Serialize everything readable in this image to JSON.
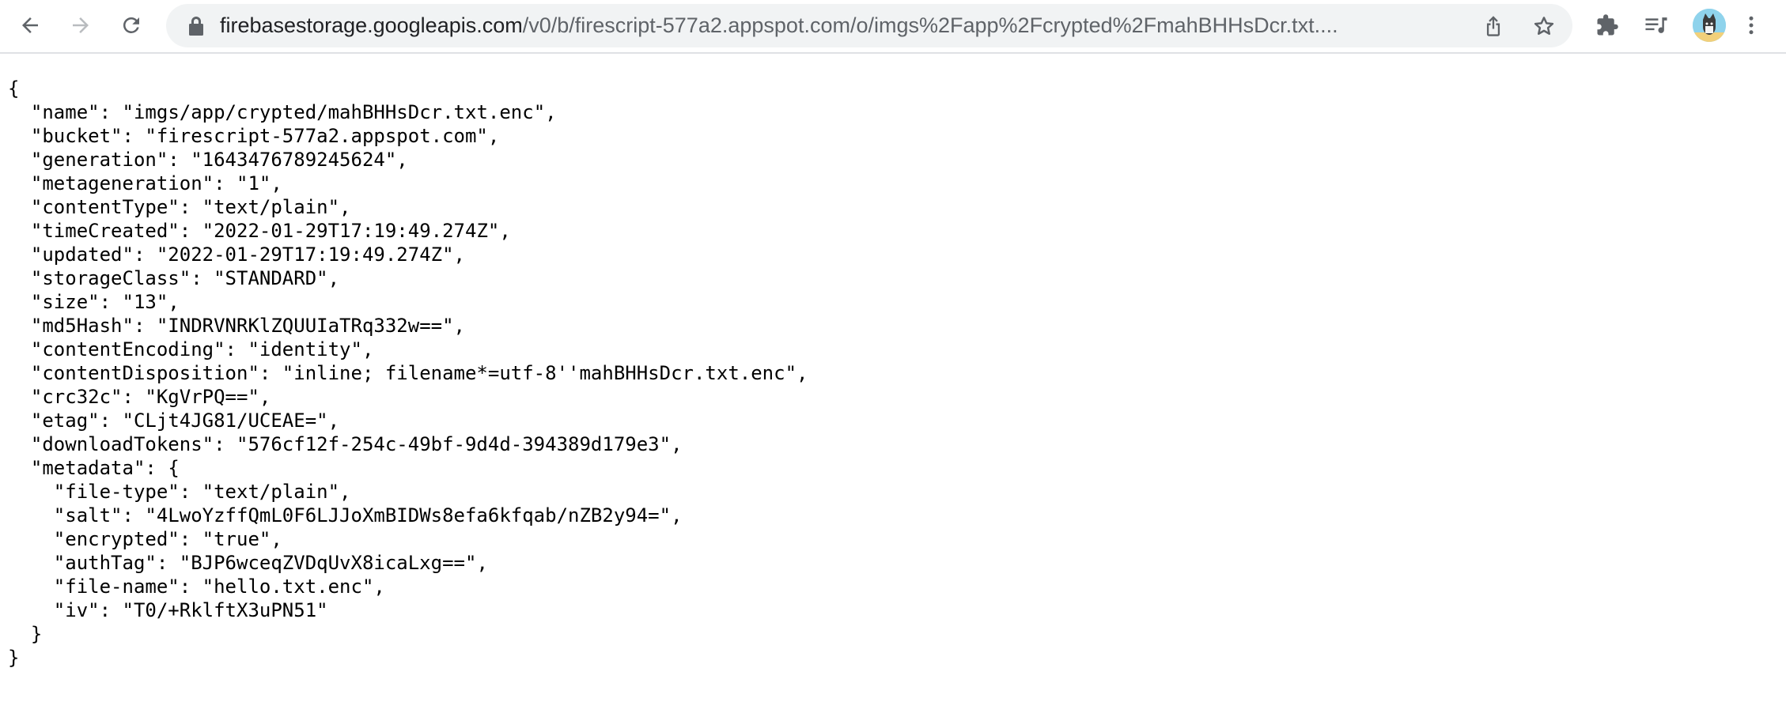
{
  "browser": {
    "url_host": "firebasestorage.googleapis.com",
    "url_path": "/v0/b/firescript-577a2.appspot.com/o/imgs%2Fapp%2Fcrypted%2FmahBHHsDcr.txt....",
    "icons": [
      "back-arrow-icon",
      "forward-arrow-icon",
      "reload-icon",
      "lock-icon",
      "share-icon",
      "star-icon",
      "extensions-puzzle-icon",
      "media-queue-icon",
      "profile-avatar",
      "kebab-menu-icon"
    ]
  },
  "json": {
    "open": "{",
    "name_key": "\"name\"",
    "name_val": "\"imgs/app/crypted/mahBHHsDcr.txt.enc\"",
    "bucket_key": "\"bucket\"",
    "bucket_val": "\"firescript-577a2.appspot.com\"",
    "generation_key": "\"generation\"",
    "generation_val": "\"1643476789245624\"",
    "metageneration_key": "\"metageneration\"",
    "metageneration_val": "\"1\"",
    "contentType_key": "\"contentType\"",
    "contentType_val": "\"text/plain\"",
    "timeCreated_key": "\"timeCreated\"",
    "timeCreated_val": "\"2022-01-29T17:19:49.274Z\"",
    "updated_key": "\"updated\"",
    "updated_val": "\"2022-01-29T17:19:49.274Z\"",
    "storageClass_key": "\"storageClass\"",
    "storageClass_val": "\"STANDARD\"",
    "size_key": "\"size\"",
    "size_val": "\"13\"",
    "md5Hash_key": "\"md5Hash\"",
    "md5Hash_val": "\"INDRVNRKlZQUUIaTRq332w==\"",
    "contentEncoding_key": "\"contentEncoding\"",
    "contentEncoding_val": "\"identity\"",
    "contentDisposition_key": "\"contentDisposition\"",
    "contentDisposition_val": "\"inline; filename*=utf-8''mahBHHsDcr.txt.enc\"",
    "crc32c_key": "\"crc32c\"",
    "crc32c_val": "\"KgVrPQ==\"",
    "etag_key": "\"etag\"",
    "etag_val": "\"CLjt4JG81/UCEAE=\"",
    "downloadTokens_key": "\"downloadTokens\"",
    "downloadTokens_val": "\"576cf12f-254c-49bf-9d4d-394389d179e3\"",
    "metadata_key": "\"metadata\"",
    "metadata_open": "{",
    "fileType_key": "\"file-type\"",
    "fileType_val": "\"text/plain\"",
    "salt_key": "\"salt\"",
    "salt_val": "\"4LwoYzffQmL0F6LJJoXmBIDWs8efa6kfqab/nZB2y94=\"",
    "encrypted_key": "\"encrypted\"",
    "encrypted_val": "\"true\"",
    "authTag_key": "\"authTag\"",
    "authTag_val": "\"BJP6wceqZVDqUvX8icaLxg==\"",
    "fileName_key": "\"file-name\"",
    "fileName_val": "\"hello.txt.enc\"",
    "iv_key": "\"iv\"",
    "iv_val": "\"T0/+RklftX3uPN51\"",
    "metadata_close": "}",
    "close": "}"
  }
}
